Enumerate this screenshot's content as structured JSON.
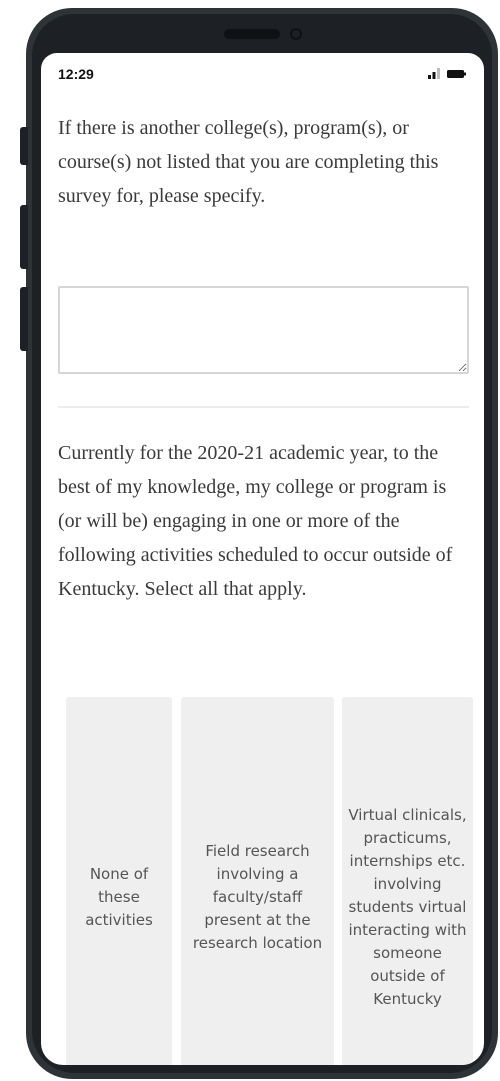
{
  "status_bar": {
    "time": "12:29",
    "signal_icon": "signal-icon",
    "battery_icon": "battery-icon"
  },
  "survey": {
    "question_other": "If there is another college(s), program(s), or course(s) not listed that you are completing this survey for, please specify.",
    "other_input_value": "",
    "question_activities": "Currently for the 2020-21 academic year, to the best of my knowledge, my college or program is (or will be) engaging in one or more of the following activities scheduled to occur outside of Kentucky. Select all that apply.",
    "choices": [
      "None of these activities",
      "Field research involving a faculty/staff present at the research location",
      "Virtual clinicals, practicums, internships etc. involving students virtual interacting with someone outside of Kentucky"
    ]
  },
  "colors": {
    "frame": "#2e3338",
    "choice_background": "#efefef",
    "question_text": "#3a3a3a",
    "choice_text": "#555555"
  }
}
